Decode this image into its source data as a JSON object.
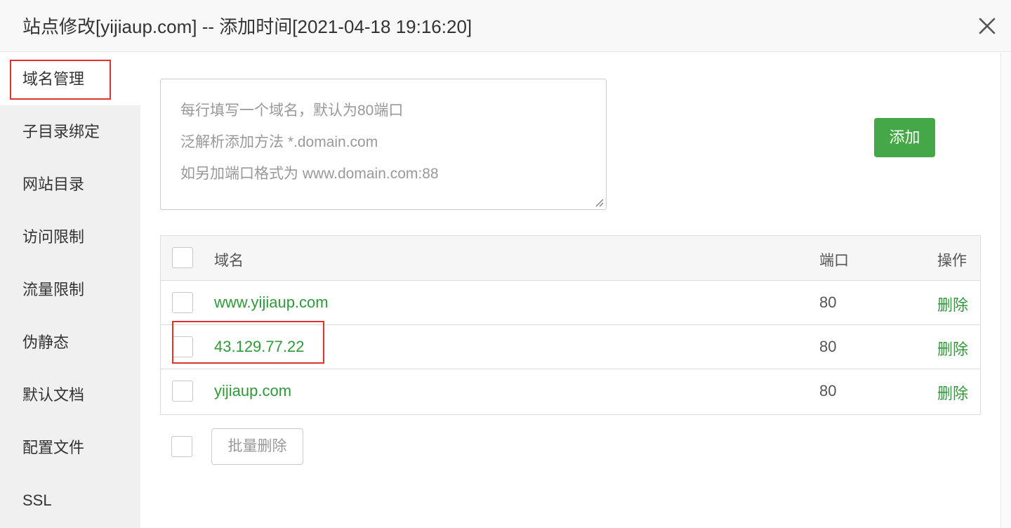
{
  "dialog": {
    "title": "站点修改[yijiaup.com] -- 添加时间[2021-04-18 19:16:20]",
    "close_icon": "close-icon"
  },
  "sidebar": {
    "items": [
      {
        "label": "域名管理",
        "active": true
      },
      {
        "label": "子目录绑定"
      },
      {
        "label": "网站目录"
      },
      {
        "label": "访问限制"
      },
      {
        "label": "流量限制"
      },
      {
        "label": "伪静态"
      },
      {
        "label": "默认文档"
      },
      {
        "label": "配置文件"
      },
      {
        "label": "SSL"
      }
    ]
  },
  "domain_input": {
    "placeholder_lines": [
      "每行填写一个域名，默认为80端口",
      "泛解析添加方法 *.domain.com",
      "如另加端口格式为 www.domain.com:88"
    ]
  },
  "add_button": {
    "label": "添加"
  },
  "table": {
    "headers": {
      "domain": "域名",
      "port": "端口",
      "action": "操作"
    },
    "rows": [
      {
        "domain": "www.yijiaup.com",
        "port": "80",
        "action": "删除"
      },
      {
        "domain": "43.129.77.22",
        "port": "80",
        "action": "删除"
      },
      {
        "domain": "yijiaup.com",
        "port": "80",
        "action": "删除"
      }
    ]
  },
  "batch_delete": {
    "label": "批量删除"
  },
  "colors": {
    "accent_green": "#44a846",
    "link_green": "#2d9a3a",
    "highlight_red": "#e0332b"
  }
}
